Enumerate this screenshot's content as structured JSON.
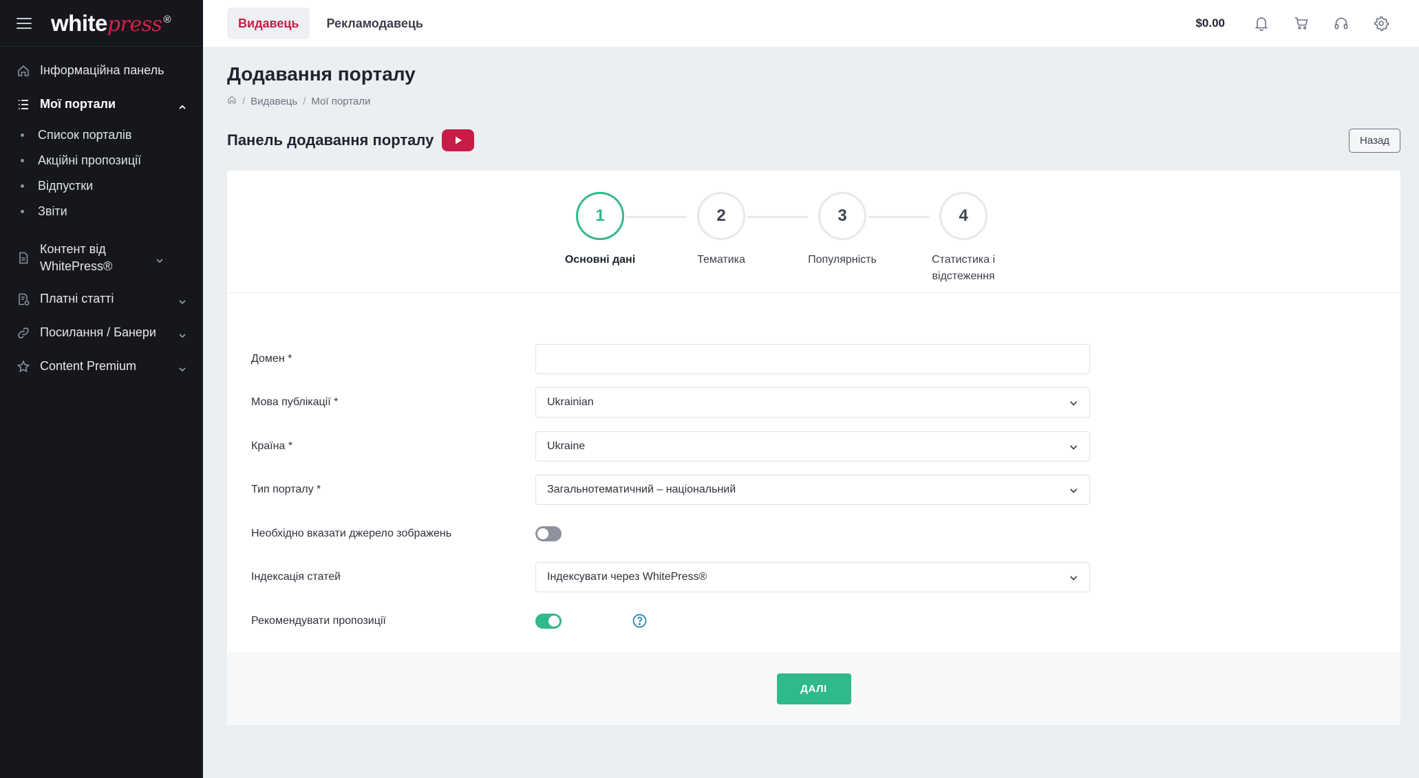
{
  "sidebar": {
    "logo_main": "white",
    "logo_accent": "press",
    "logo_reg": "®",
    "items": [
      {
        "label": "Інформаційна панель",
        "icon": "home-icon"
      },
      {
        "label": "Мої портали",
        "icon": "list-icon"
      },
      {
        "label": "Контент від WhitePress®",
        "icon": "document-icon"
      },
      {
        "label": "Платні статті",
        "icon": "paid-article-icon"
      },
      {
        "label": "Посилання / Банери",
        "icon": "link-icon"
      },
      {
        "label": "Content Premium",
        "icon": "star-icon"
      }
    ],
    "subitems": [
      "Список порталів",
      "Акційні пропозиції",
      "Відпустки",
      "Звіти"
    ]
  },
  "topbar": {
    "tabs": [
      "Видавець",
      "Рекламодавець"
    ],
    "active_tab": "Видавець",
    "balance": "$0.00"
  },
  "page": {
    "title": "Додавання порталу",
    "breadcrumb": [
      "Видавець",
      "Мої портали"
    ],
    "panel_title": "Панель додавання порталу",
    "back_label": "Назад"
  },
  "stepper": {
    "steps": [
      {
        "num": "1",
        "label": "Основні дані"
      },
      {
        "num": "2",
        "label": "Тематика"
      },
      {
        "num": "3",
        "label": "Популярність"
      },
      {
        "num": "4",
        "label": "Статистика і відстеження"
      }
    ],
    "current": 1
  },
  "form": {
    "domain": {
      "label": "Домен *",
      "value": ""
    },
    "language": {
      "label": "Мова публікації *",
      "value": "Ukrainian"
    },
    "country": {
      "label": "Країна *",
      "value": "Ukraine"
    },
    "portal_type": {
      "label": "Тип порталу *",
      "value": "Загальнотематичний – національний"
    },
    "image_source": {
      "label": "Необхідно вказати джерело зображень",
      "enabled": false
    },
    "indexing": {
      "label": "Індексація статей",
      "value": "Індексувати через WhitePress®"
    },
    "recommend": {
      "label": "Рекомендувати пропозиції",
      "enabled": true
    }
  },
  "footer": {
    "next_label": "ДАЛІ"
  },
  "colors": {
    "accent": "#c81b45",
    "success": "#2fb98c",
    "sidebar_bg": "#15171c"
  }
}
